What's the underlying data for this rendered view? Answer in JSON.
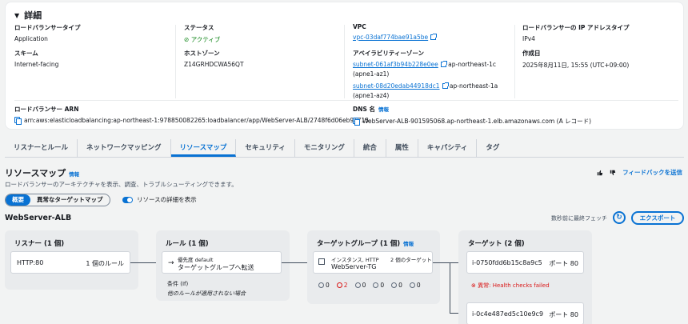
{
  "details": {
    "title": "詳細",
    "lb_type": {
      "label": "ロードバランサータイプ",
      "value": "Application"
    },
    "status": {
      "label": "ステータス",
      "value": "アクティブ"
    },
    "vpc": {
      "label": "VPC",
      "value": "vpc-03daf774bae91a5be"
    },
    "ip_type": {
      "label": "ロードバランサーの IP アドレスタイプ",
      "value": "IPv4"
    },
    "scheme": {
      "label": "スキーム",
      "value": "Internet-facing"
    },
    "hosted_zone": {
      "label": "ホストゾーン",
      "value": "Z14GRHDCWA56QT"
    },
    "az": {
      "label": "アベイラビリティーゾーン",
      "items": [
        {
          "subnet": "subnet-061af3b94b228e0ee",
          "region": "ap-northeast-1c",
          "az_id": "(apne1-az1)"
        },
        {
          "subnet": "subnet-08d20edab44918dc1",
          "region": "ap-northeast-1a",
          "az_id": "(apne1-az4)"
        }
      ]
    },
    "created": {
      "label": "作成日",
      "value": "2025年8月11日, 15:55 (UTC+09:00)"
    },
    "arn": {
      "label": "ロードバランサー ARN",
      "value": "arn:aws:elasticloadbalancing:ap-northeast-1:978850082265:loadbalancer/app/WebServer-ALB/2748f6d06eb9a715"
    },
    "dns": {
      "label": "DNS 名",
      "info": "情報",
      "value": "WebServer-ALB-901595068.ap-northeast-1.elb.amazonaws.com (A レコード)"
    }
  },
  "tabs": [
    "リスナーとルール",
    "ネットワークマッピング",
    "リソースマップ",
    "セキュリティ",
    "モニタリング",
    "統合",
    "属性",
    "キャパシティ",
    "タグ"
  ],
  "resource_map": {
    "title": "リソースマップ",
    "info": "情報",
    "description": "ロードバランサーのアーキテクチャを表示、調査、トラブルシューティングできます。",
    "feedback": "フィードバックを送信",
    "view_overview": "概要",
    "view_abnormal": "異常なターゲットマップ",
    "toggle_label": "リソースの詳細を表示",
    "lb_name": "WebServer-ALB",
    "fetched": "数秒前に最終フェッチ",
    "export": "エクスポート",
    "listeners": {
      "title": "リスナー (1 個)",
      "protocol": "HTTP:80",
      "rules": "1 個のルール"
    },
    "rules": {
      "title": "ルール (1 個)",
      "priority": "優先度 default",
      "action": "ターゲットグループへ転送",
      "cond_label": "条件 (If)",
      "cond_text": "他のルールが適用されない場合"
    },
    "target_groups": {
      "title": "ターゲットグループ (1 個)",
      "info": "情報",
      "type": "インスタンス, HTTP",
      "name": "WebServer-TG",
      "targets": "2 個のターゲット",
      "counts": [
        "0",
        "2",
        "0",
        "0",
        "0",
        "0"
      ]
    },
    "targets": {
      "title": "ターゲット (2 個)",
      "items": [
        {
          "id": "i-0750fdd6b15c8a9c5",
          "port": "ポート 80",
          "status": "異常: Health checks failed"
        },
        {
          "id": "i-0c4e487ed5c10e9c9",
          "port": "ポート 80"
        }
      ]
    }
  }
}
